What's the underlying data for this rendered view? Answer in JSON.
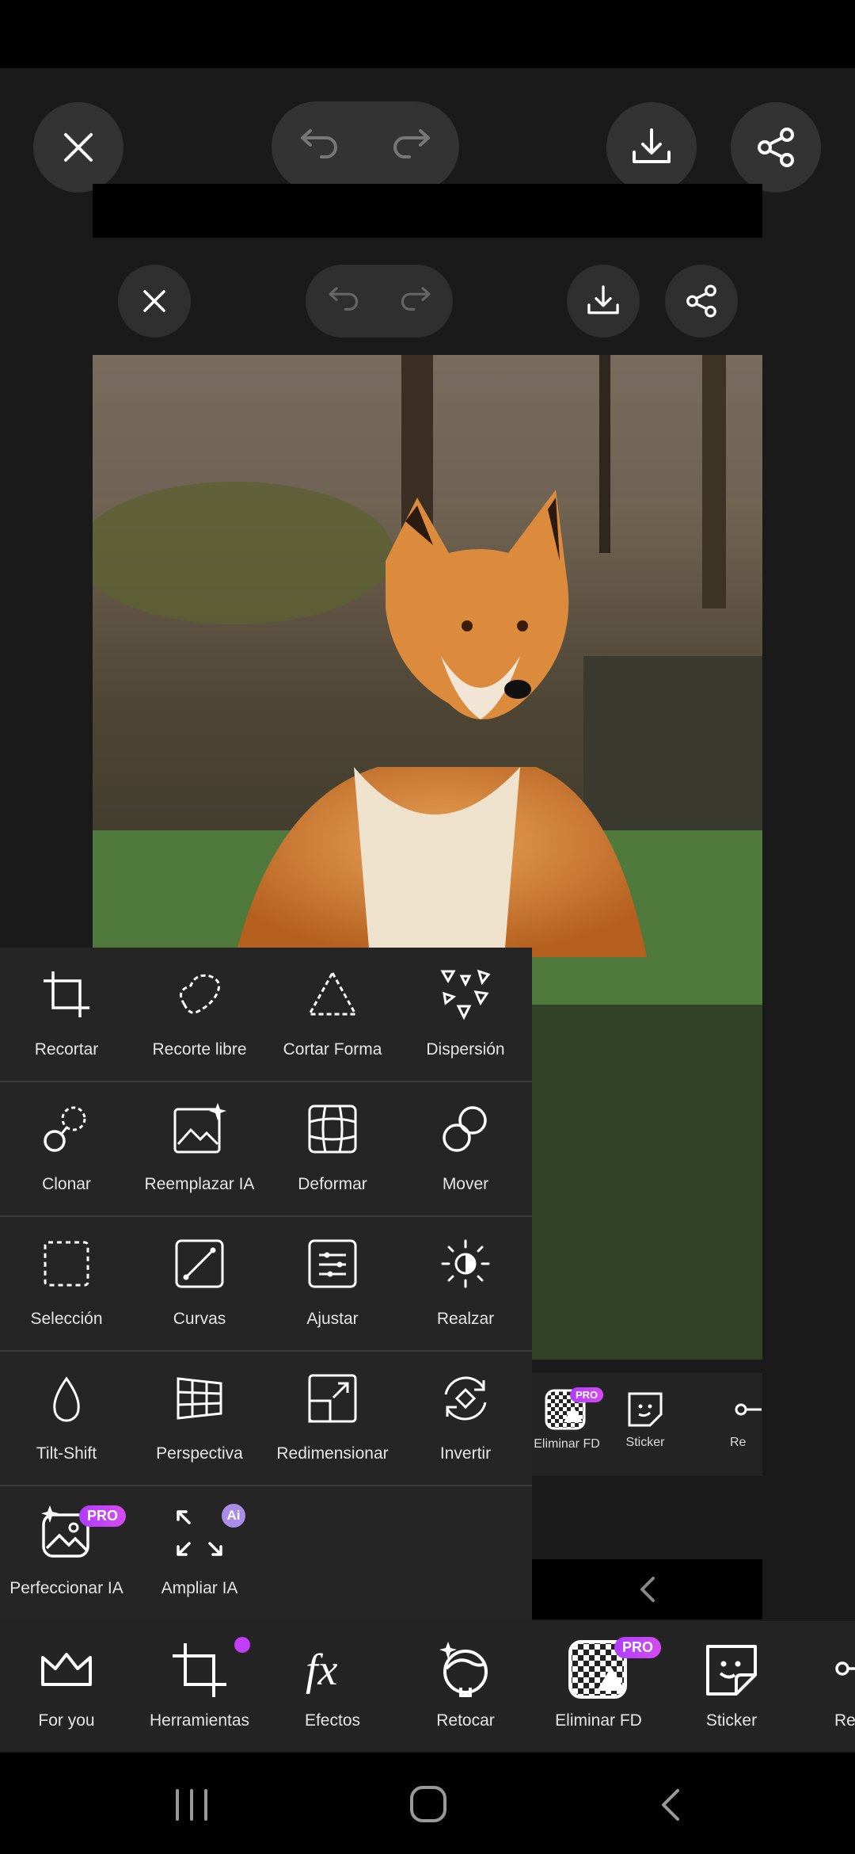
{
  "outer_toolbar": {
    "close_icon": "close-icon",
    "undo_icon": "undo-icon",
    "redo_icon": "redo-icon",
    "download_icon": "download-icon",
    "share_icon": "share-icon"
  },
  "photo": {
    "subject": "fox-photo"
  },
  "strip": {
    "items": [
      {
        "label": "Eliminar FD",
        "badge": "PRO"
      },
      {
        "label": "Sticker"
      },
      {
        "label": "Re"
      }
    ]
  },
  "tools_panel": {
    "rows": [
      [
        {
          "label": "Recortar",
          "icon": "crop-icon"
        },
        {
          "label": "Recorte libre",
          "icon": "freeform-crop-icon"
        },
        {
          "label": "Cortar Forma",
          "icon": "shape-crop-icon"
        },
        {
          "label": "Dispersión",
          "icon": "dispersion-icon"
        }
      ],
      [
        {
          "label": "Clonar",
          "icon": "clone-icon"
        },
        {
          "label": "Reemplazar IA",
          "icon": "ai-replace-icon"
        },
        {
          "label": "Deformar",
          "icon": "warp-icon"
        },
        {
          "label": "Mover",
          "icon": "move-icon"
        }
      ],
      [
        {
          "label": "Selección",
          "icon": "selection-icon"
        },
        {
          "label": "Curvas",
          "icon": "curves-icon"
        },
        {
          "label": "Ajustar",
          "icon": "adjust-icon"
        },
        {
          "label": "Realzar",
          "icon": "enhance-icon"
        }
      ],
      [
        {
          "label": "Tilt-Shift",
          "icon": "tilt-shift-icon"
        },
        {
          "label": "Perspectiva",
          "icon": "perspective-icon"
        },
        {
          "label": "Redimensionar",
          "icon": "resize-icon"
        },
        {
          "label": "Invertir",
          "icon": "invert-icon"
        }
      ],
      [
        {
          "label": "Perfeccionar IA",
          "icon": "ai-enhance-icon",
          "badge": "PRO"
        },
        {
          "label": "Ampliar IA",
          "icon": "ai-upscale-icon",
          "badge": "Ai"
        }
      ]
    ]
  },
  "bottom_tabs": [
    {
      "label": "For you",
      "icon": "crown-icon"
    },
    {
      "label": "Herramientas",
      "icon": "crop-tool-icon",
      "dot": true
    },
    {
      "label": "Efectos",
      "icon": "fx-icon"
    },
    {
      "label": "Retocar",
      "icon": "retouch-face-icon"
    },
    {
      "label": "Eliminar FD",
      "icon": "remove-bg-icon",
      "badge": "PRO"
    },
    {
      "label": "Sticker",
      "icon": "sticker-icon"
    },
    {
      "label": "Re",
      "icon": "partial-icon"
    }
  ],
  "nav": {
    "recents_icon": "recents-icon",
    "home_icon": "home-icon",
    "back_icon": "back-icon"
  },
  "colors": {
    "accent": "#c13ef8",
    "panel": "#252525",
    "background": "#1a1a1a"
  }
}
